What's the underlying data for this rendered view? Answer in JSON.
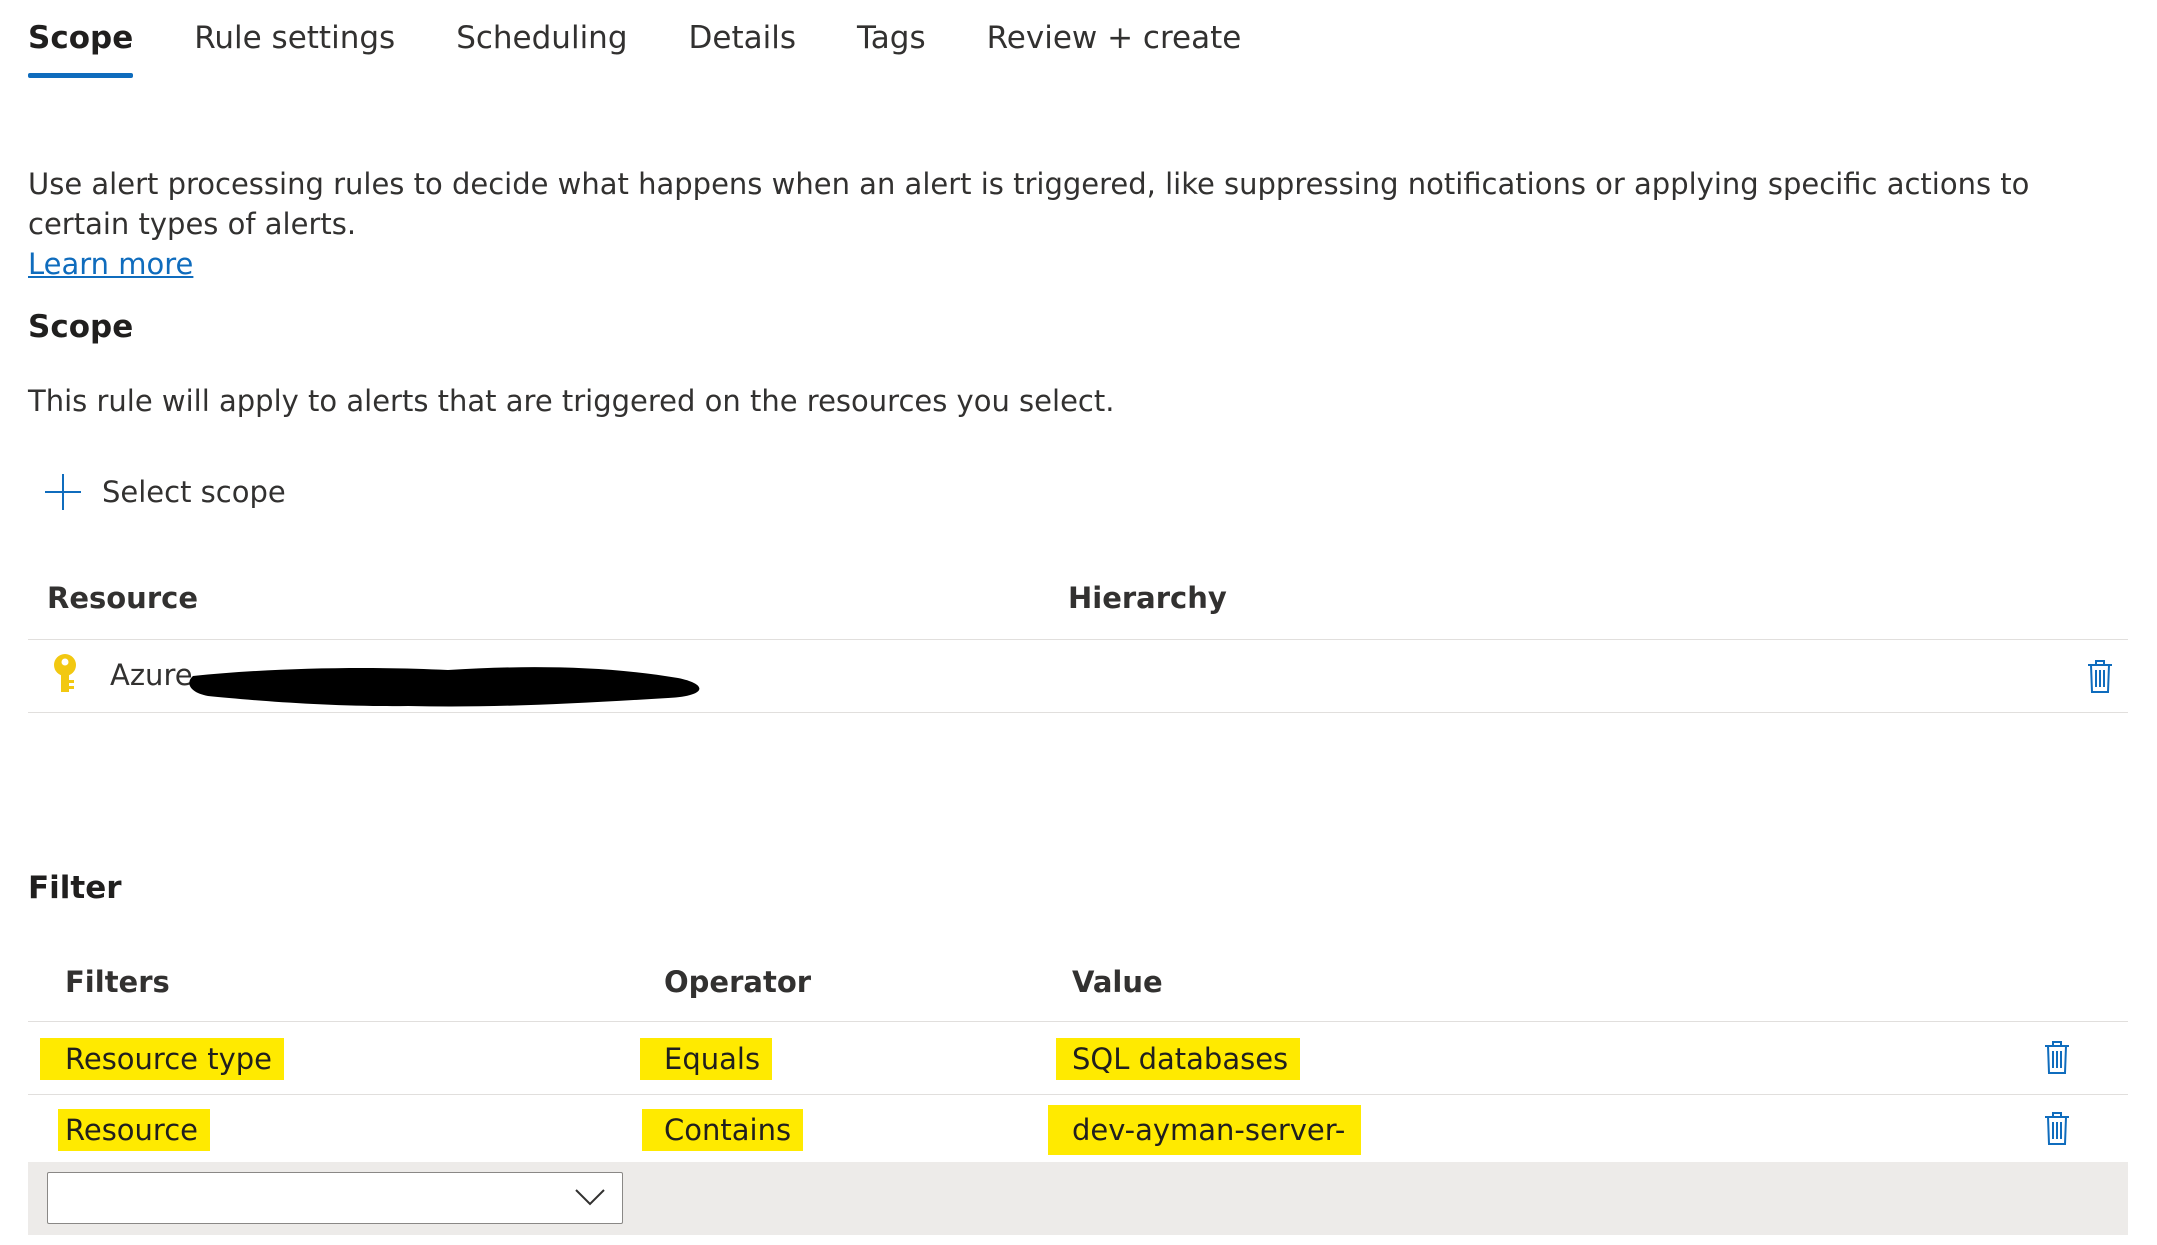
{
  "tabs": [
    "Scope",
    "Rule settings",
    "Scheduling",
    "Details",
    "Tags",
    "Review + create"
  ],
  "intro": {
    "text": "Use alert processing rules to decide what happens when an alert is triggered, like suppressing notifications or applying specific actions to certain types of alerts.",
    "link": "Learn more"
  },
  "scope": {
    "heading": "Scope",
    "description": "This rule will apply to alerts that are triggered on the resources you select.",
    "select_button": "Select scope",
    "columns": {
      "resource": "Resource",
      "hierarchy": "Hierarchy"
    },
    "rows": [
      {
        "name": "Azure"
      }
    ]
  },
  "filter": {
    "heading": "Filter",
    "columns": {
      "filters": "Filters",
      "operator": "Operator",
      "value": "Value"
    },
    "rows": [
      {
        "filter": "Resource type",
        "operator": "Equals",
        "value": "SQL databases"
      },
      {
        "filter": "Resource",
        "operator": "Contains",
        "value": "dev-ayman-server-"
      }
    ],
    "new_filter_value": ""
  },
  "colors": {
    "accent": "#0f6cbd",
    "highlight": "#ffea00",
    "key": "#f2c811"
  }
}
